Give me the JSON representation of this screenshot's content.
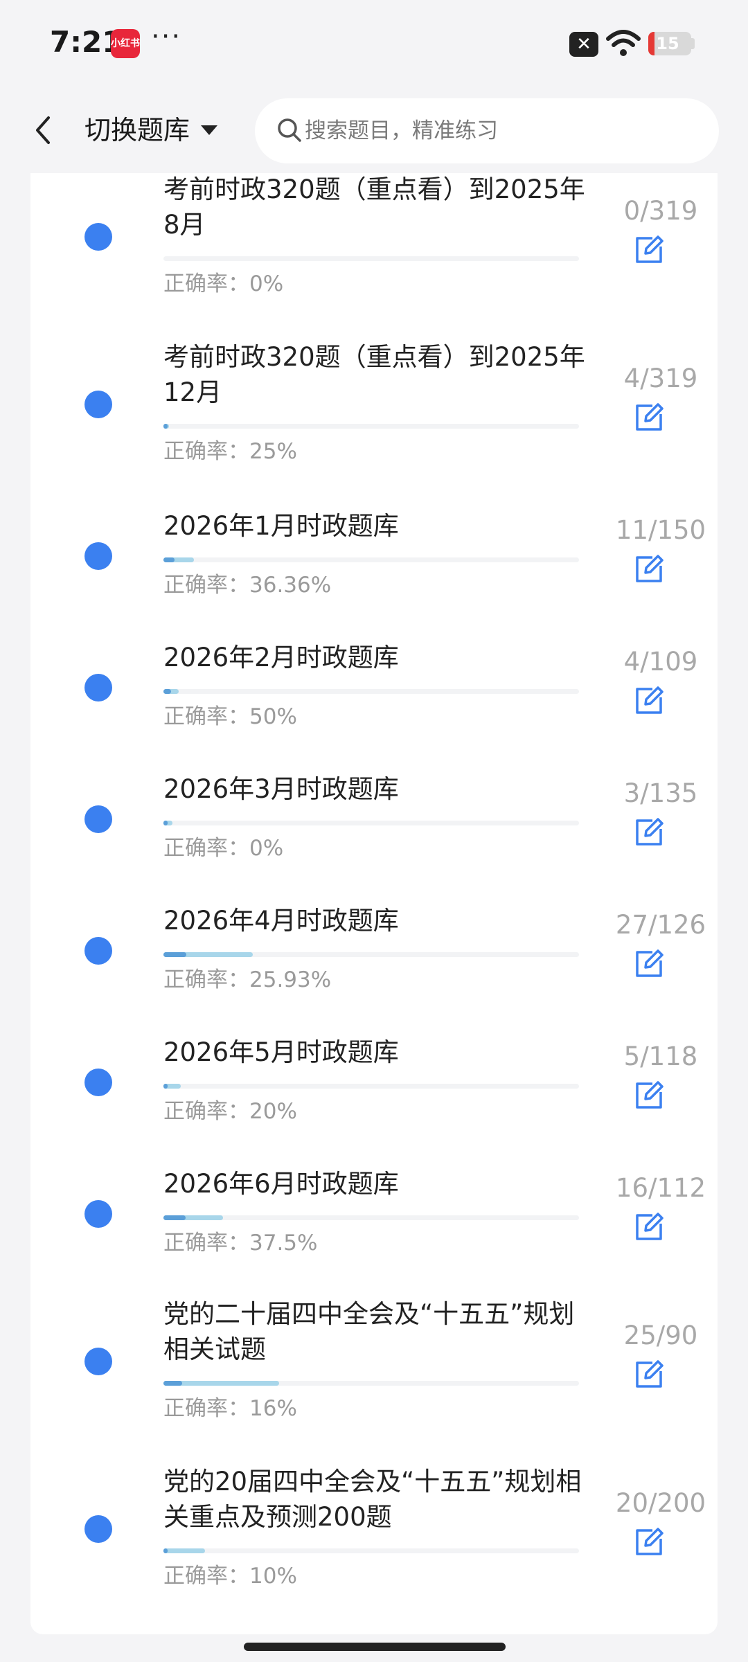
{
  "status_bar": {
    "time": "7:21",
    "app_badge": "小红书",
    "dots": "···",
    "battery": "15",
    "battery_level": 0.15,
    "icons": [
      "close-badge-icon",
      "wifi-icon",
      "battery-icon"
    ]
  },
  "header": {
    "switch_label": "切换题库",
    "search_placeholder": "搜索题目，精准练习"
  },
  "colors": {
    "dot": "#3b80f0",
    "edit_icon": "#3b80f0",
    "bar_correct": "#5b9fd8",
    "bar_attempted": "#a8d6ea",
    "battery_low": "#e53935"
  },
  "question_banks": [
    {
      "title": "考前时政320题（重点看）到2025年8月",
      "done": 0,
      "total": 319,
      "count": "0/319",
      "accuracy": "正确率：0%",
      "accuracy_value": 0
    },
    {
      "title": "考前时政320题（重点看）到2025年12月",
      "done": 4,
      "total": 319,
      "count": "4/319",
      "accuracy": "正确率：25%",
      "accuracy_value": 0.25
    },
    {
      "title": "2026年1月时政题库",
      "done": 11,
      "total": 150,
      "count": "11/150",
      "accuracy": "正确率：36.36%",
      "accuracy_value": 0.3636
    },
    {
      "title": "2026年2月时政题库",
      "done": 4,
      "total": 109,
      "count": "4/109",
      "accuracy": "正确率：50%",
      "accuracy_value": 0.5
    },
    {
      "title": "2026年3月时政题库",
      "done": 3,
      "total": 135,
      "count": "3/135",
      "accuracy": "正确率：0%",
      "accuracy_value": 0
    },
    {
      "title": "2026年4月时政题库",
      "done": 27,
      "total": 126,
      "count": "27/126",
      "accuracy": "正确率：25.93%",
      "accuracy_value": 0.2593
    },
    {
      "title": "2026年5月时政题库",
      "done": 5,
      "total": 118,
      "count": "5/118",
      "accuracy": "正确率：20%",
      "accuracy_value": 0.2
    },
    {
      "title": "2026年6月时政题库",
      "done": 16,
      "total": 112,
      "count": "16/112",
      "accuracy": "正确率：37.5%",
      "accuracy_value": 0.375
    },
    {
      "title": "党的二十届四中全会及“十五五”规划相关试题",
      "done": 25,
      "total": 90,
      "count": "25/90",
      "accuracy": "正确率：16%",
      "accuracy_value": 0.16
    },
    {
      "title": "党的20届四中全会及“十五五”规划相关重点及预测200题",
      "done": 20,
      "total": 200,
      "count": "20/200",
      "accuracy": "正确率：10%",
      "accuracy_value": 0.1
    }
  ]
}
